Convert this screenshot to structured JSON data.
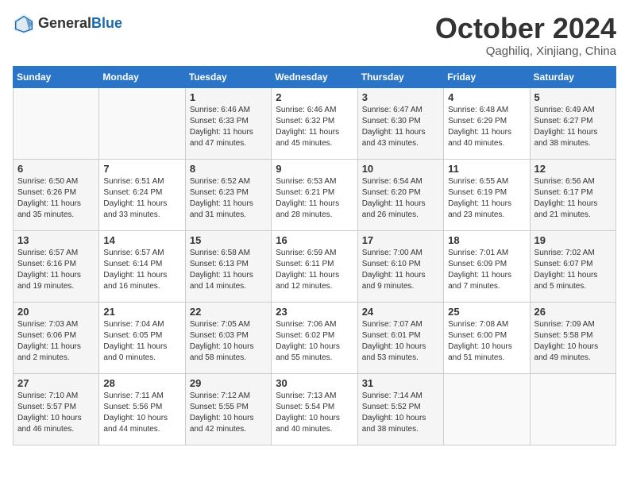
{
  "header": {
    "logo_general": "General",
    "logo_blue": "Blue",
    "month_title": "October 2024",
    "subtitle": "Qaghiliq, Xinjiang, China"
  },
  "weekdays": [
    "Sunday",
    "Monday",
    "Tuesday",
    "Wednesday",
    "Thursday",
    "Friday",
    "Saturday"
  ],
  "weeks": [
    [
      {
        "day": "",
        "info": ""
      },
      {
        "day": "",
        "info": ""
      },
      {
        "day": "1",
        "info": "Sunrise: 6:46 AM\nSunset: 6:33 PM\nDaylight: 11 hours and 47 minutes."
      },
      {
        "day": "2",
        "info": "Sunrise: 6:46 AM\nSunset: 6:32 PM\nDaylight: 11 hours and 45 minutes."
      },
      {
        "day": "3",
        "info": "Sunrise: 6:47 AM\nSunset: 6:30 PM\nDaylight: 11 hours and 43 minutes."
      },
      {
        "day": "4",
        "info": "Sunrise: 6:48 AM\nSunset: 6:29 PM\nDaylight: 11 hours and 40 minutes."
      },
      {
        "day": "5",
        "info": "Sunrise: 6:49 AM\nSunset: 6:27 PM\nDaylight: 11 hours and 38 minutes."
      }
    ],
    [
      {
        "day": "6",
        "info": "Sunrise: 6:50 AM\nSunset: 6:26 PM\nDaylight: 11 hours and 35 minutes."
      },
      {
        "day": "7",
        "info": "Sunrise: 6:51 AM\nSunset: 6:24 PM\nDaylight: 11 hours and 33 minutes."
      },
      {
        "day": "8",
        "info": "Sunrise: 6:52 AM\nSunset: 6:23 PM\nDaylight: 11 hours and 31 minutes."
      },
      {
        "day": "9",
        "info": "Sunrise: 6:53 AM\nSunset: 6:21 PM\nDaylight: 11 hours and 28 minutes."
      },
      {
        "day": "10",
        "info": "Sunrise: 6:54 AM\nSunset: 6:20 PM\nDaylight: 11 hours and 26 minutes."
      },
      {
        "day": "11",
        "info": "Sunrise: 6:55 AM\nSunset: 6:19 PM\nDaylight: 11 hours and 23 minutes."
      },
      {
        "day": "12",
        "info": "Sunrise: 6:56 AM\nSunset: 6:17 PM\nDaylight: 11 hours and 21 minutes."
      }
    ],
    [
      {
        "day": "13",
        "info": "Sunrise: 6:57 AM\nSunset: 6:16 PM\nDaylight: 11 hours and 19 minutes."
      },
      {
        "day": "14",
        "info": "Sunrise: 6:57 AM\nSunset: 6:14 PM\nDaylight: 11 hours and 16 minutes."
      },
      {
        "day": "15",
        "info": "Sunrise: 6:58 AM\nSunset: 6:13 PM\nDaylight: 11 hours and 14 minutes."
      },
      {
        "day": "16",
        "info": "Sunrise: 6:59 AM\nSunset: 6:11 PM\nDaylight: 11 hours and 12 minutes."
      },
      {
        "day": "17",
        "info": "Sunrise: 7:00 AM\nSunset: 6:10 PM\nDaylight: 11 hours and 9 minutes."
      },
      {
        "day": "18",
        "info": "Sunrise: 7:01 AM\nSunset: 6:09 PM\nDaylight: 11 hours and 7 minutes."
      },
      {
        "day": "19",
        "info": "Sunrise: 7:02 AM\nSunset: 6:07 PM\nDaylight: 11 hours and 5 minutes."
      }
    ],
    [
      {
        "day": "20",
        "info": "Sunrise: 7:03 AM\nSunset: 6:06 PM\nDaylight: 11 hours and 2 minutes."
      },
      {
        "day": "21",
        "info": "Sunrise: 7:04 AM\nSunset: 6:05 PM\nDaylight: 11 hours and 0 minutes."
      },
      {
        "day": "22",
        "info": "Sunrise: 7:05 AM\nSunset: 6:03 PM\nDaylight: 10 hours and 58 minutes."
      },
      {
        "day": "23",
        "info": "Sunrise: 7:06 AM\nSunset: 6:02 PM\nDaylight: 10 hours and 55 minutes."
      },
      {
        "day": "24",
        "info": "Sunrise: 7:07 AM\nSunset: 6:01 PM\nDaylight: 10 hours and 53 minutes."
      },
      {
        "day": "25",
        "info": "Sunrise: 7:08 AM\nSunset: 6:00 PM\nDaylight: 10 hours and 51 minutes."
      },
      {
        "day": "26",
        "info": "Sunrise: 7:09 AM\nSunset: 5:58 PM\nDaylight: 10 hours and 49 minutes."
      }
    ],
    [
      {
        "day": "27",
        "info": "Sunrise: 7:10 AM\nSunset: 5:57 PM\nDaylight: 10 hours and 46 minutes."
      },
      {
        "day": "28",
        "info": "Sunrise: 7:11 AM\nSunset: 5:56 PM\nDaylight: 10 hours and 44 minutes."
      },
      {
        "day": "29",
        "info": "Sunrise: 7:12 AM\nSunset: 5:55 PM\nDaylight: 10 hours and 42 minutes."
      },
      {
        "day": "30",
        "info": "Sunrise: 7:13 AM\nSunset: 5:54 PM\nDaylight: 10 hours and 40 minutes."
      },
      {
        "day": "31",
        "info": "Sunrise: 7:14 AM\nSunset: 5:52 PM\nDaylight: 10 hours and 38 minutes."
      },
      {
        "day": "",
        "info": ""
      },
      {
        "day": "",
        "info": ""
      }
    ]
  ]
}
